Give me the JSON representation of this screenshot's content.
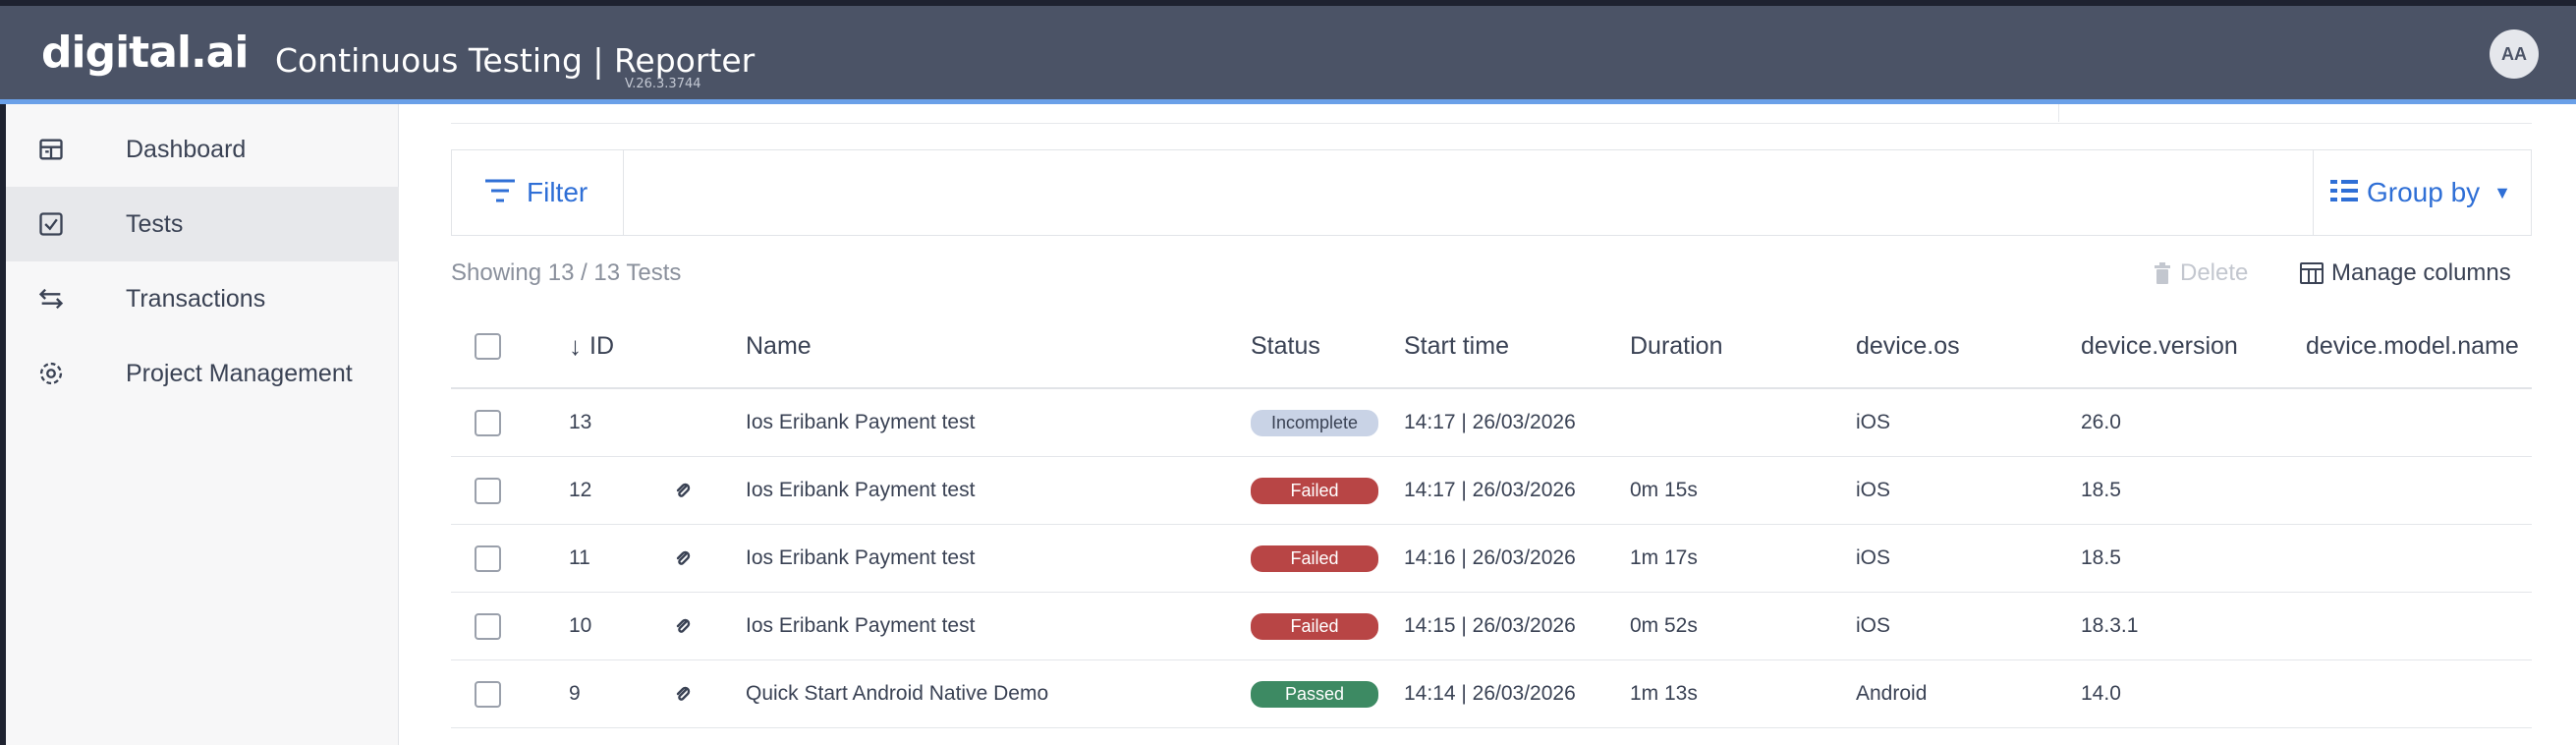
{
  "header": {
    "logo": "digital.ai",
    "title": "Continuous Testing | Reporter",
    "version": "V.26.3.3744",
    "avatar_initials": "AA"
  },
  "sidebar": {
    "items": [
      {
        "label": "Dashboard",
        "icon": "dashboard-icon",
        "active": false
      },
      {
        "label": "Tests",
        "icon": "tests-checkbox-icon",
        "active": true
      },
      {
        "label": "Transactions",
        "icon": "transactions-arrows-icon",
        "active": false
      },
      {
        "label": "Project Management",
        "icon": "gear-icon",
        "active": false
      }
    ]
  },
  "toolbar": {
    "filter_label": "Filter",
    "group_by_label": "Group by",
    "showing_text": "Showing 13 / 13 Tests",
    "delete_label": "Delete",
    "manage_columns_label": "Manage columns"
  },
  "table": {
    "columns": [
      "ID",
      "Name",
      "Status",
      "Start time",
      "Duration",
      "device.os",
      "device.version",
      "device.model.name"
    ],
    "sort": {
      "column": "ID",
      "direction": "descending"
    },
    "rows": [
      {
        "id": "13",
        "attachment": false,
        "name": "Ios Eribank Payment test",
        "status": "Incomplete",
        "start_time": "14:17 | 26/03/2026",
        "duration": "",
        "os": "iOS",
        "version": "26.0",
        "model": ""
      },
      {
        "id": "12",
        "attachment": true,
        "name": "Ios Eribank Payment test",
        "status": "Failed",
        "start_time": "14:17 | 26/03/2026",
        "duration": "0m 15s",
        "os": "iOS",
        "version": "18.5",
        "model": ""
      },
      {
        "id": "11",
        "attachment": true,
        "name": "Ios Eribank Payment test",
        "status": "Failed",
        "start_time": "14:16 | 26/03/2026",
        "duration": "1m 17s",
        "os": "iOS",
        "version": "18.5",
        "model": ""
      },
      {
        "id": "10",
        "attachment": true,
        "name": "Ios Eribank Payment test",
        "status": "Failed",
        "start_time": "14:15 | 26/03/2026",
        "duration": "0m 52s",
        "os": "iOS",
        "version": "18.3.1",
        "model": ""
      },
      {
        "id": "9",
        "attachment": true,
        "name": "Quick Start Android Native Demo",
        "status": "Passed",
        "start_time": "14:14 | 26/03/2026",
        "duration": "1m 13s",
        "os": "Android",
        "version": "14.0",
        "model": ""
      }
    ]
  },
  "colors": {
    "topbar": "#4b5366",
    "accent": "#2f6fd6",
    "failed": "#b84545",
    "passed": "#3d8a63",
    "incomplete": "#c9d3e6"
  }
}
